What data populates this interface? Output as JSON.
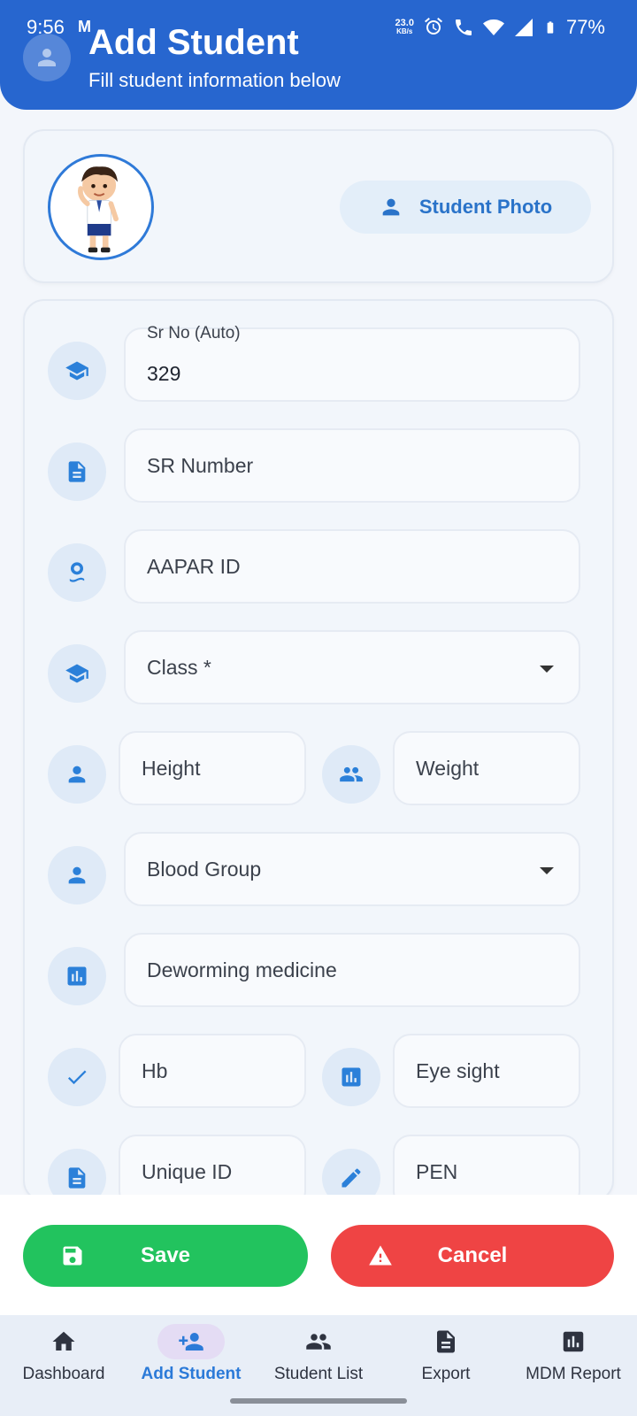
{
  "status_bar": {
    "time": "9:56",
    "carrier_mark": "M",
    "net_speed_value": "23.0",
    "net_speed_unit": "KB/s",
    "battery": "77%"
  },
  "header": {
    "title": "Add Student",
    "subtitle": "Fill student information below"
  },
  "photo": {
    "button_label": "Student Photo"
  },
  "form": {
    "sr_no_label": "Sr No (Auto)",
    "sr_no_value": "329",
    "sr_number_placeholder": "SR Number",
    "aapar_placeholder": "AAPAR ID",
    "class_placeholder": "Class *",
    "height_placeholder": "Height",
    "weight_placeholder": "Weight",
    "blood_group_placeholder": "Blood Group",
    "deworming_placeholder": "Deworming medicine",
    "hb_placeholder": "Hb",
    "eye_sight_placeholder": "Eye sight",
    "unique_id_placeholder": "Unique ID",
    "pen_placeholder": "PEN"
  },
  "actions": {
    "save_label": "Save",
    "cancel_label": "Cancel"
  },
  "bottom_nav": {
    "items": [
      {
        "label": "Dashboard",
        "icon": "home-icon"
      },
      {
        "label": "Add Student",
        "icon": "person-add-icon",
        "active": true
      },
      {
        "label": "Student List",
        "icon": "group-icon"
      },
      {
        "label": "Export",
        "icon": "document-icon"
      },
      {
        "label": "MDM Report",
        "icon": "bar-chart-icon"
      }
    ]
  },
  "colors": {
    "primary": "#2766cf",
    "accent": "#2b80d9",
    "save": "#22c35e",
    "cancel": "#ef4444"
  }
}
